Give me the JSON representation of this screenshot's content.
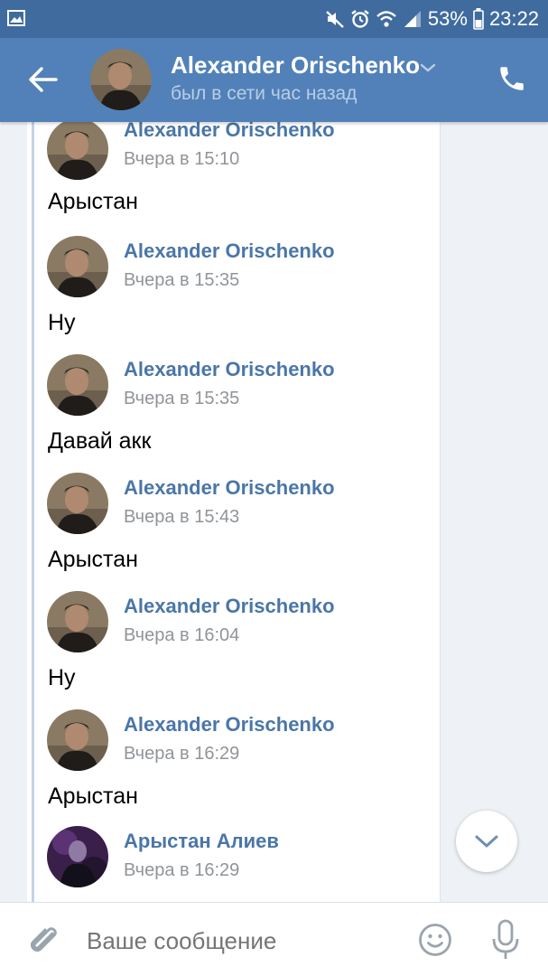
{
  "status_bar": {
    "battery": "53%",
    "time": "23:22",
    "icons": [
      "gallery-icon",
      "mute-icon",
      "alarm-icon",
      "wifi-icon",
      "signal-icon",
      "battery-icon"
    ]
  },
  "header": {
    "name": "Alexander Orischenko",
    "status": "был в сети час назад",
    "icons": [
      "back-arrow-icon",
      "chevron-down-icon",
      "phone-icon"
    ]
  },
  "messages": [
    {
      "author": "Alexander Orischenko",
      "time": "Вчера в 15:10",
      "text": "Арыстан",
      "avatar": "alexander"
    },
    {
      "author": "Alexander Orischenko",
      "time": "Вчера в 15:35",
      "text": "Ну",
      "avatar": "alexander"
    },
    {
      "author": "Alexander Orischenko",
      "time": "Вчера в 15:35",
      "text": "Давай акк",
      "avatar": "alexander"
    },
    {
      "author": "Alexander Orischenko",
      "time": "Вчера в 15:43",
      "text": "Арыстан",
      "avatar": "alexander"
    },
    {
      "author": "Alexander Orischenko",
      "time": "Вчера в 16:04",
      "text": "Ну",
      "avatar": "alexander"
    },
    {
      "author": "Alexander Orischenko",
      "time": "Вчера в 16:29",
      "text": "Арыстан",
      "avatar": "alexander"
    },
    {
      "author": "Арыстан Алиев",
      "time": "Вчера в 16:29",
      "text": "",
      "avatar": "arystan"
    }
  ],
  "input": {
    "placeholder": "Ваше сообщение",
    "icons": [
      "paperclip-icon",
      "emoji-icon",
      "microphone-icon"
    ]
  },
  "colors": {
    "status_bar": "#3f6b9f",
    "header": "#5181b8",
    "author_link": "#4a76a8",
    "timestamp": "#909499",
    "background": "#eef1f5"
  }
}
